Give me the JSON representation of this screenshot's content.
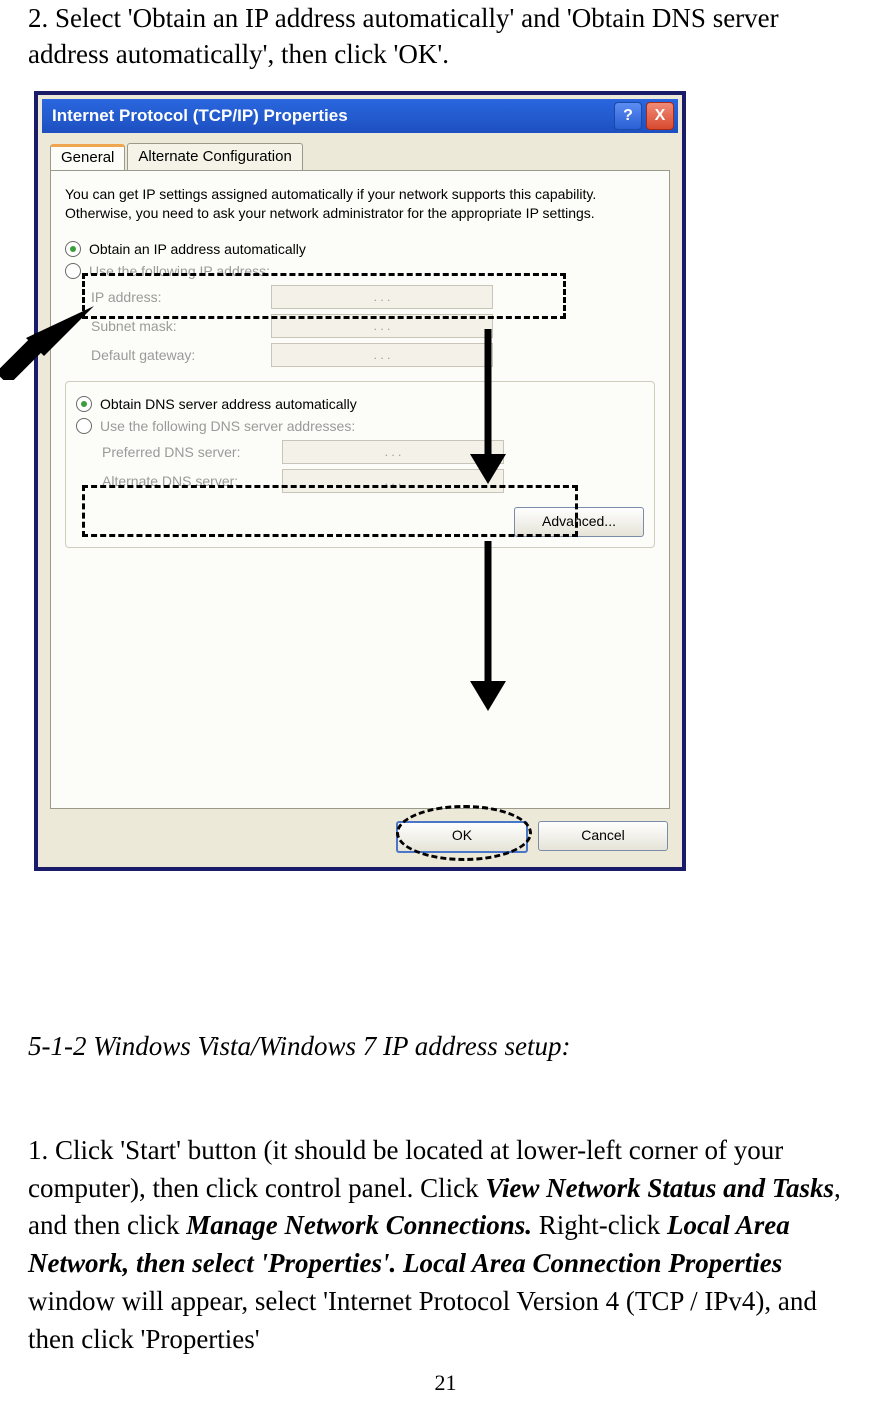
{
  "page_number": "21",
  "instruction_text": "2. Select 'Obtain an IP address automatically' and 'Obtain DNS server address automatically', then click 'OK'.",
  "heading": "5-1-2 Windows Vista/Windows 7 IP address setup:",
  "body": {
    "p1a": "1. Click 'Start' button (it should be located at lower-left corner of your computer), then click control panel. Click ",
    "b1": "View Network Status and Tasks",
    "p1b": ", and then click ",
    "b2": "Manage Network Connections.",
    "p1c": " Right-click ",
    "b3": "Local Area Network, then select 'Properties'. Local Area Connection Properties",
    "p1d": " window will appear, select 'Internet Protocol Version 4 (TCP / IPv4), and then click 'Properties'"
  },
  "dialog": {
    "title": "Internet Protocol (TCP/IP) Properties",
    "help": "?",
    "close": "X",
    "tabs": {
      "general": "General",
      "alt": "Alternate Configuration"
    },
    "description": "You can get IP settings assigned automatically if your network supports this capability. Otherwise, you need to ask your network administrator for the appropriate IP settings.",
    "radio_ip_auto": "Obtain an IP address automatically",
    "radio_ip_manual": "Use the following IP address:",
    "labels": {
      "ip": "IP address:",
      "subnet": "Subnet mask:",
      "gateway": "Default gateway:",
      "pref_dns": "Preferred DNS server:",
      "alt_dns": "Alternate DNS server:"
    },
    "radio_dns_auto": "Obtain DNS server address automatically",
    "radio_dns_manual": "Use the following DNS server addresses:",
    "ip_dots": ".    .    .",
    "advanced": "Advanced...",
    "ok": "OK",
    "cancel": "Cancel"
  }
}
